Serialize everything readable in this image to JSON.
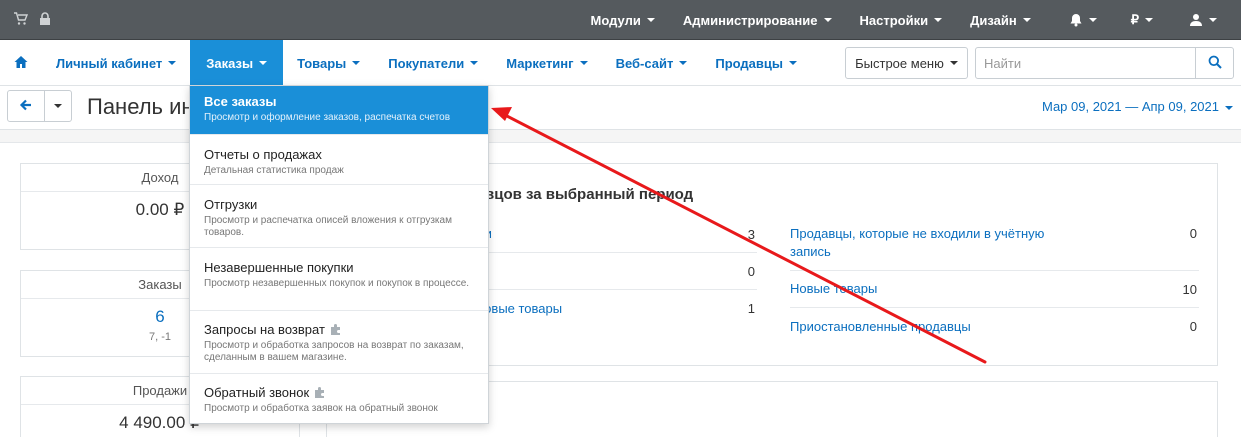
{
  "topbar": {
    "menu": [
      {
        "label": "Модули"
      },
      {
        "label": "Администрирование"
      },
      {
        "label": "Настройки"
      },
      {
        "label": "Дизайн"
      }
    ],
    "currency": "₽"
  },
  "nav": {
    "items": [
      {
        "label": "Личный кабинет"
      },
      {
        "label": "Заказы"
      },
      {
        "label": "Товары"
      },
      {
        "label": "Покупатели"
      },
      {
        "label": "Маркетинг"
      },
      {
        "label": "Веб-сайт"
      },
      {
        "label": "Продавцы"
      }
    ],
    "quick_menu": "Быстрое меню",
    "search_placeholder": "Найти"
  },
  "title": {
    "text": "Панель инструментов",
    "date_range": "Мар 09, 2021 — Апр 09, 2021"
  },
  "stats": [
    {
      "label": "Доход",
      "value": "0.00 ₽",
      "sub": ""
    },
    {
      "label": "Заказы",
      "value": "6",
      "sub": "7, -1"
    },
    {
      "label": "Продажи",
      "value": "4 490.00 ₽",
      "sub": ""
    }
  ],
  "vendors": {
    "title": "вцов за выбранный период",
    "left": [
      {
        "label": "ли",
        "value": "3"
      },
      {
        "label": "",
        "value": "0"
      },
      {
        "label": "новые товары",
        "value": "1"
      }
    ],
    "right": [
      {
        "label": "Продавцы, которые не входили в учётную запись",
        "value": "0"
      },
      {
        "label": "Новые товары",
        "value": "10"
      },
      {
        "label": "Приостановленные продавцы",
        "value": "0"
      }
    ]
  },
  "dropdown": {
    "items": [
      {
        "title": "Все заказы",
        "desc": "Просмотр и оформление заказов, распечатка счетов"
      },
      {
        "title": "Отчеты о продажах",
        "desc": "Детальная статистика продаж"
      },
      {
        "title": "Отгрузки",
        "desc": "Просмотр и распечатка описей вложения к отгрузкам товаров."
      },
      {
        "title": "Незавершенные покупки",
        "desc": "Просмотр незавершенных покупок и покупок в процессе."
      },
      {
        "title": "Запросы на возврат",
        "desc": "Просмотр и обработка запросов на возврат по заказам, сделанным в вашем магазине."
      },
      {
        "title": "Обратный звонок",
        "desc": "Просмотр и обработка заявок на обратный звонок"
      }
    ]
  },
  "colors": {
    "accent": "#1a8fd8",
    "link": "#0b6fbf",
    "topbar": "#555a5e",
    "annotation_arrow": "#e8191b"
  }
}
